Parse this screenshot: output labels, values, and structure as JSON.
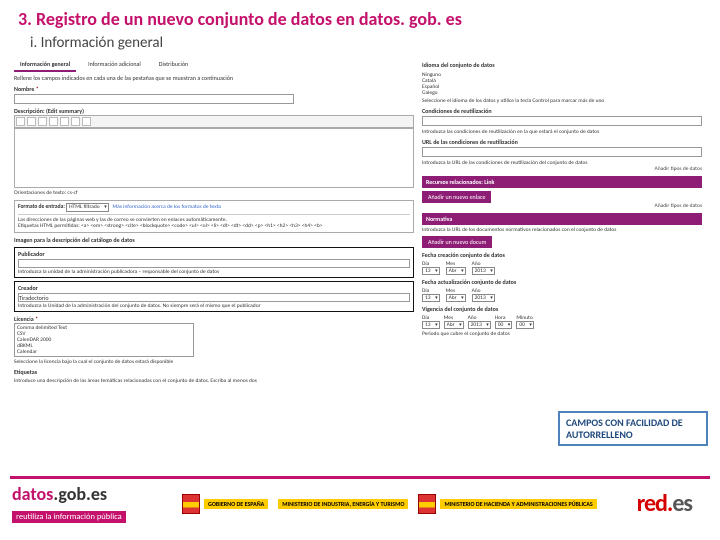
{
  "title": "3. Registro de un nuevo conjunto de datos en datos. gob. es",
  "subtitle": "i. Información general",
  "tabs": [
    "Información general",
    "Información adicional",
    "Distribución"
  ],
  "left": {
    "hint": "Rellene los campos indicados en cada una de las pestañas que se muestran a continuación",
    "nombre": "Nombre",
    "descripcion": "Descripción: (Edit summary)",
    "guidance": "Orientaciones de texto: cs-cf",
    "htmlTitle": "Formato de entrada:",
    "htmlSel": "HTML filtrado",
    "htmlLink": "Más información acerca de los formatos de texto",
    "htmlLines": [
      "Las direcciones de las páginas web y las de correo se convierten en enlaces automáticamente.",
      "Etiquetas HTML permitidas: <a> <em> <strong> <cite> <blockquote> <code> <ul> <ol> <li> <dl> <dt> <dd> <p> <h1> <h2> <h3> <h4> <b>"
    ],
    "imagen": "Imagen para la descripción del catálogo de datos",
    "publicador": {
      "label": "Publicador",
      "desc": "Introduzca la unidad de la administración publicadora – responsable del conjunto de datos"
    },
    "creador": {
      "label": "Creador",
      "placeholder": "Tiradectorio",
      "desc": "Introduzca la Unidad de la administración del conjunto de datos. No siempre será el mismo que el publicador"
    },
    "licencia": {
      "label": "Licencia",
      "options": [
        "Comma delimited Text",
        "CSV",
        "CalenDAR 2000",
        "dBKML",
        "Calendar"
      ],
      "desc": "Seleccione la licencia bajo la cual el conjunto de datos estará disponible"
    },
    "etiquetas": "Etiquetas",
    "etiquetasDesc": "Introduce una descripción de las áreas temáticas relacionadas con el conjunto de datos. Escriba al menos dos"
  },
  "right": {
    "idioma": {
      "label": "Idioma del conjunto de datos",
      "items": [
        "Ninguno",
        "Català",
        "Español",
        "Galego"
      ],
      "desc": "Seleccione el idioma de los datos y utilice la tecla Control para marcar más de uno"
    },
    "condiciones": {
      "label": "Condiciones de reutilización",
      "desc": "Introduzca las condiciones de reutilización en la que estará el conjunto de datos"
    },
    "url": {
      "label": "URL de las condiciones de reutilización",
      "desc": "Introduzca la URL de las condiciones de reutilización del conjunto de datos"
    },
    "anadir": "Añadir tipos de datos",
    "recursos": {
      "title": "Recursos relacionados: Link",
      "btn": "Añadir un nuevo enlace"
    },
    "normativa": {
      "title": "Normativa",
      "desc": "Introduzca la URL de los documentos normativos relacionados con el conjunto de datos",
      "btn": "Añadir un nuevo docum"
    },
    "fechaCreacion": "Fecha creación conjunto de datos",
    "fechaAct": "Fecha actualización conjunto de datos",
    "dmy": {
      "dia": "Día",
      "mes": "Mes",
      "ano": "Año",
      "hora": "Hora",
      "minuto": "Minuto"
    },
    "vals": {
      "dia": "13",
      "mes": "Abr",
      "ano": "2013",
      "hora": "00",
      "minuto": "00"
    },
    "vigencia": "Vigencia del conjunto de datos",
    "periodo": "Periodo que cubre el conjunto de datos"
  },
  "callout": "CAMPOS CON FACILIDAD DE AUTORRELLENO",
  "footer": {
    "datos": "datos",
    "gobes": ".gob.es",
    "tag": "reutiliza la información pública",
    "gob": "GOBIERNO DE ESPAÑA",
    "min1": "MINISTERIO DE INDUSTRIA, ENERGÍA Y TURISMO",
    "min2": "MINISTERIO DE HACIENDA Y ADMINISTRACIONES PÚBLICAS"
  }
}
